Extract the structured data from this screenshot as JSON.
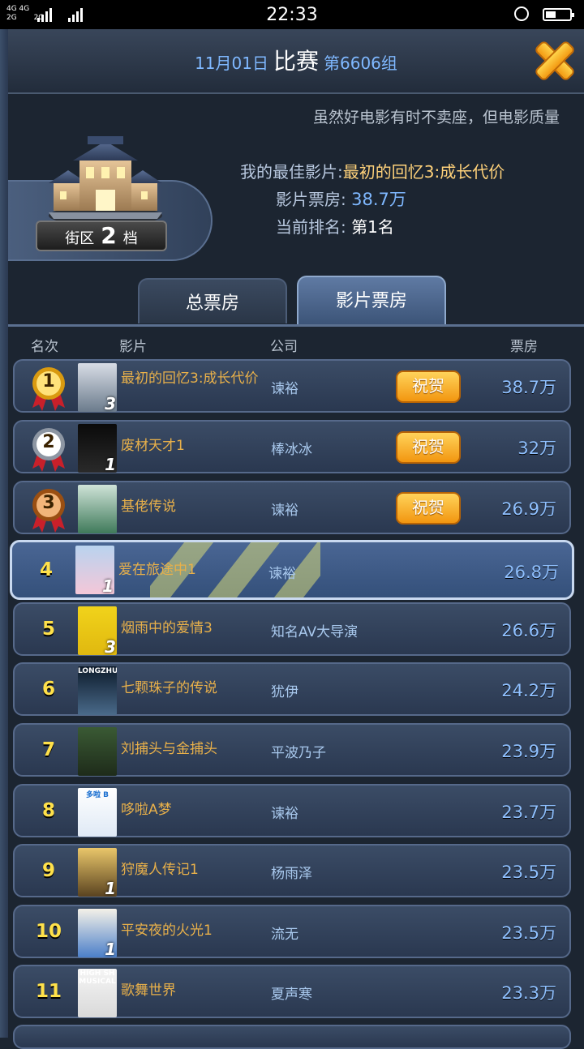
{
  "status_bar": {
    "network": [
      "4G 4G",
      "2G",
      "2G"
    ],
    "time": "22:33"
  },
  "header": {
    "date": "11月01日",
    "title": "比赛",
    "group": "第6606组"
  },
  "ticker": "虽然好电影有时不卖座，但电影质量",
  "district": {
    "label": "街区",
    "level": "2",
    "unit": "档"
  },
  "my_info": {
    "best_label": "我的最佳影片:",
    "best_value": "最初的回忆3:成长代价",
    "box_label": "影片票房:",
    "box_value": "38.7万",
    "rank_label": "当前排名:",
    "rank_value": "第1名"
  },
  "tabs": [
    {
      "label": "总票房",
      "active": false
    },
    {
      "label": "影片票房",
      "active": true
    }
  ],
  "columns": {
    "rank": "名次",
    "film": "影片",
    "company": "公司",
    "box": "票房"
  },
  "congrats_label": "祝贺",
  "rows": [
    {
      "rank": "1",
      "film": "最初的回忆3:成长代价",
      "company": "谏裕",
      "box": "38.7万",
      "medal": "gold",
      "seq": "3"
    },
    {
      "rank": "2",
      "film": "废材天才1",
      "company": "棒冰冰",
      "box": "32万",
      "medal": "silver",
      "seq": "1"
    },
    {
      "rank": "3",
      "film": "基佬传说",
      "company": "谏裕",
      "box": "26.9万",
      "medal": "bronze",
      "seq": ""
    },
    {
      "rank": "4",
      "film": "爱在旅途中1",
      "company": "谏裕",
      "box": "26.8万",
      "seq": "1"
    },
    {
      "rank": "5",
      "film": "烟雨中的爱情3",
      "company": "知名AV大导演",
      "box": "26.6万",
      "seq": "3"
    },
    {
      "rank": "6",
      "film": "七颗珠子的传说",
      "company": "犹伊",
      "box": "24.2万",
      "seq": "",
      "poster_text": "LONGZHU"
    },
    {
      "rank": "7",
      "film": "刘捕头与金捕头",
      "company": "平波乃子",
      "box": "23.9万",
      "seq": ""
    },
    {
      "rank": "8",
      "film": "哆啦A梦",
      "company": "谏裕",
      "box": "23.7万",
      "seq": "",
      "poster_text": "多啦 B"
    },
    {
      "rank": "9",
      "film": "狩魔人传记1",
      "company": "杨雨泽",
      "box": "23.5万",
      "seq": "1"
    },
    {
      "rank": "10",
      "film": "平安夜的火光1",
      "company": "流无",
      "box": "23.5万",
      "seq": "1"
    },
    {
      "rank": "11",
      "film": "歌舞世界",
      "company": "夏声寒",
      "box": "23.3万",
      "seq": "",
      "poster_text": "HIGH SH MUSICAL"
    }
  ],
  "colors": {
    "gold": "#f2c230",
    "silver": "#cfd6df",
    "bronze": "#c97a2e",
    "accent_blue": "#7fb8ff",
    "film_gold": "#e8b04a"
  }
}
